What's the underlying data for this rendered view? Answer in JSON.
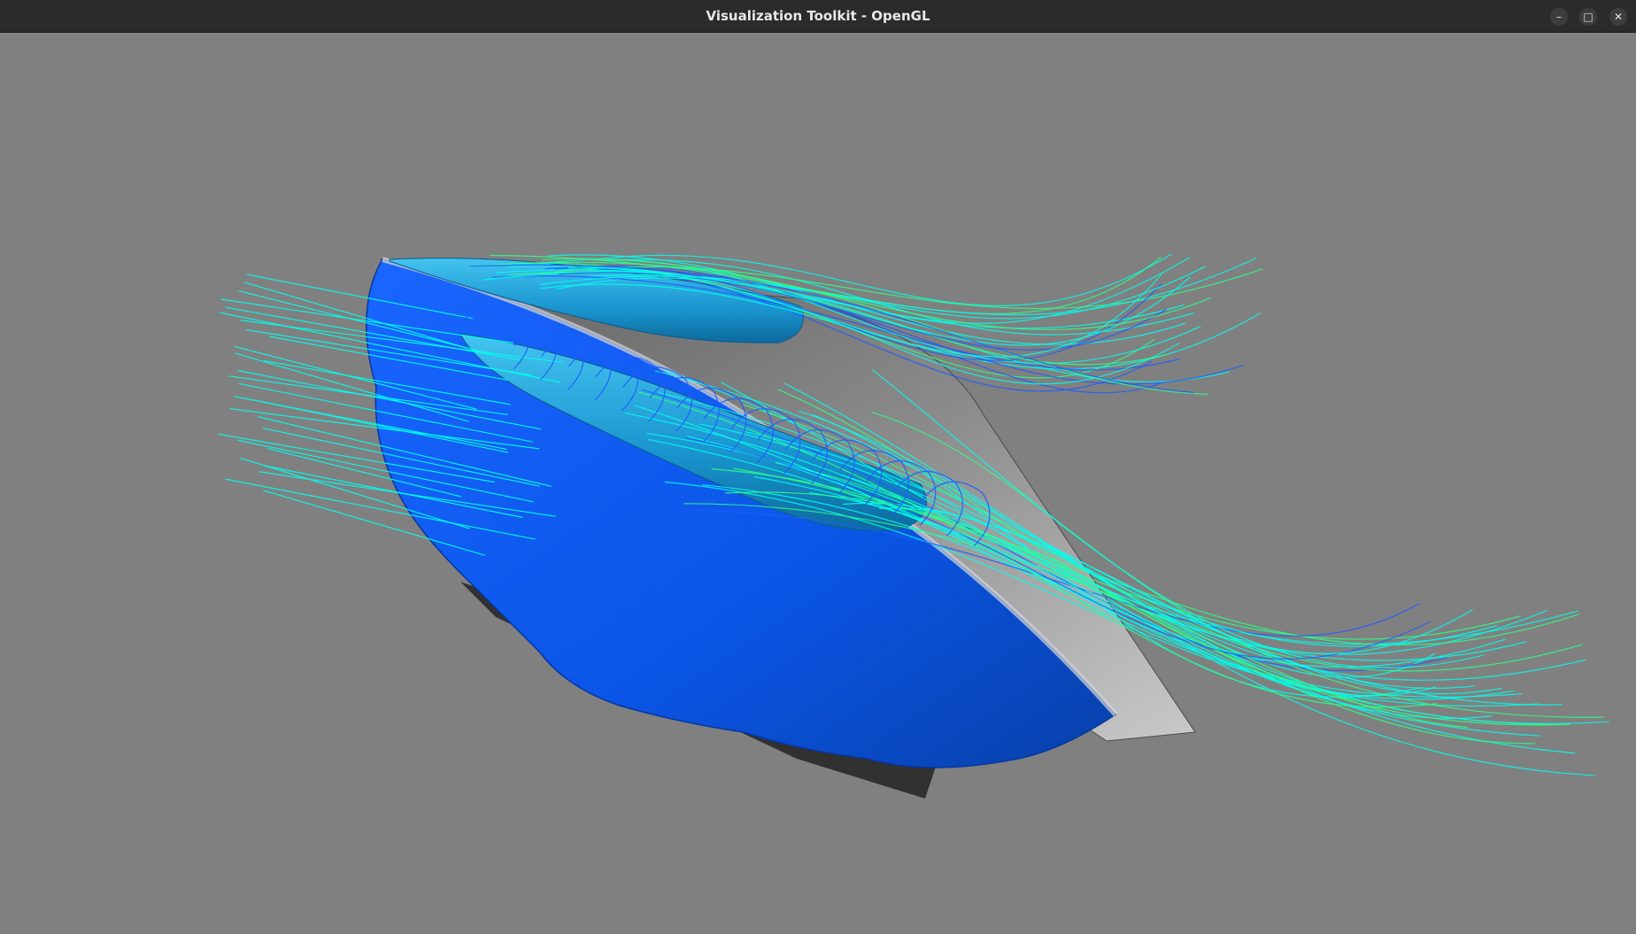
{
  "window": {
    "title": "Visualization Toolkit - OpenGL",
    "background_color": "#808080",
    "controls": {
      "minimize_icon": "minimize-icon",
      "maximize_icon": "maximize-icon",
      "close_icon": "close-icon"
    }
  },
  "scene": {
    "isosurface_color": "#0a5cf0",
    "vortex_tube_color": "#1a9fd6",
    "wing_surface_color": "#8c8c8c",
    "streamline_colors": [
      "#00ffee",
      "#1f5cff",
      "#2bff8a"
    ]
  }
}
